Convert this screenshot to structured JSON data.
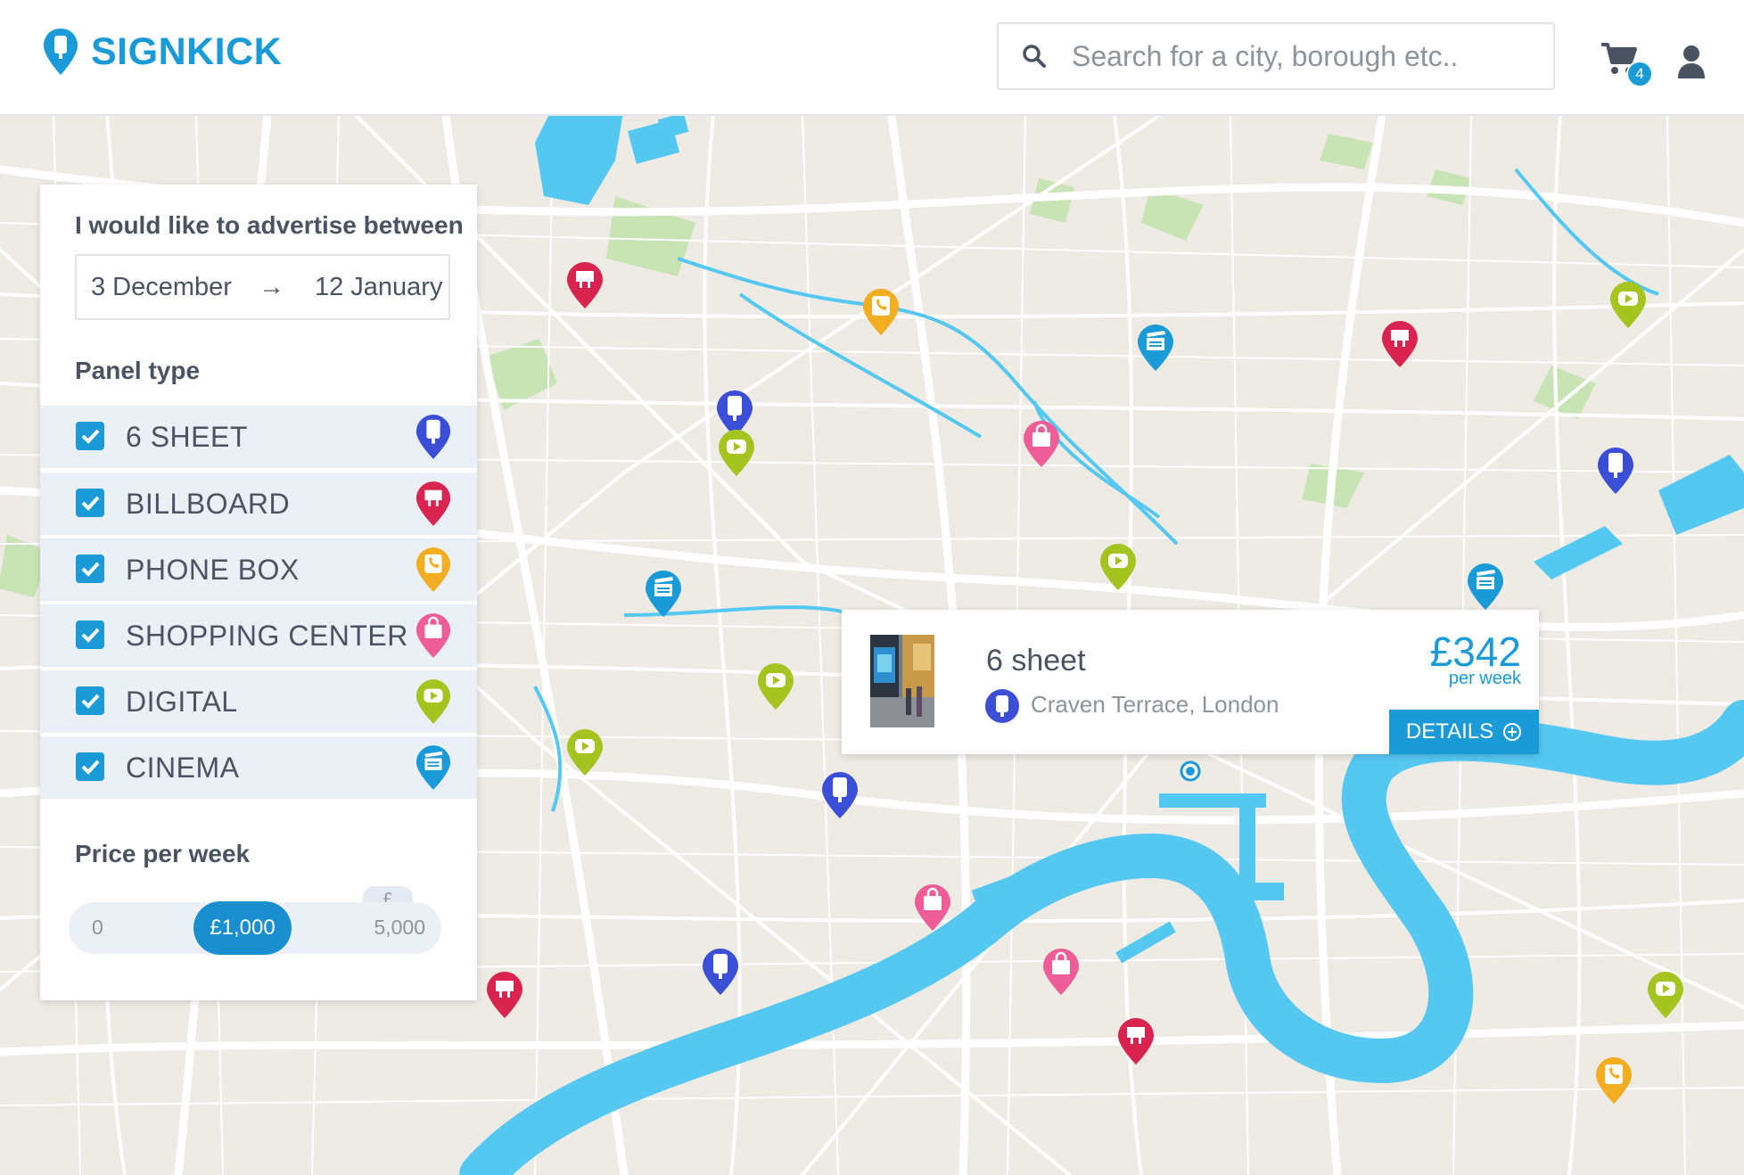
{
  "header": {
    "brand": "SIGNKICK",
    "search_placeholder": "Search for a city, borough etc..",
    "cart_count": "4",
    "icons": [
      "location-pin-logo-icon",
      "search-icon",
      "cart-icon",
      "user-icon"
    ]
  },
  "filters": {
    "title": "I would like to advertise between",
    "date_start": "3 December",
    "date_arrow": "→",
    "date_end": "12 January",
    "panel_type_label": "Panel type",
    "panel_types": [
      {
        "label": "6 SHEET",
        "checked": true,
        "icon": "six-sheet-icon",
        "color": "#3a4fd6"
      },
      {
        "label": "BILLBOARD",
        "checked": true,
        "icon": "billboard-icon",
        "color": "#d8244f"
      },
      {
        "label": "PHONE BOX",
        "checked": true,
        "icon": "phone-icon",
        "color": "#f2ad20"
      },
      {
        "label": "SHOPPING CENTER",
        "checked": true,
        "icon": "shopping-bag-icon",
        "color": "#ee5d98"
      },
      {
        "label": "DIGITAL",
        "checked": true,
        "icon": "play-icon",
        "color": "#a5c420"
      },
      {
        "label": "CINEMA",
        "checked": true,
        "icon": "clapper-icon",
        "color": "#1a9ad6"
      }
    ],
    "price_label": "Price per week",
    "price_min": "0",
    "price_value": "£1,000",
    "price_max": "5,000",
    "currency": "£"
  },
  "popup": {
    "title": "6 sheet",
    "address": "Craven Terrace, London",
    "price": "£342",
    "period": "per week",
    "details_label": "DETAILS"
  },
  "colors": {
    "accent": "#1a9ad6",
    "map_land": "#eeeae4",
    "map_water": "#55c8f2",
    "map_park": "#c9e4b4",
    "roads": "#ffffff"
  }
}
